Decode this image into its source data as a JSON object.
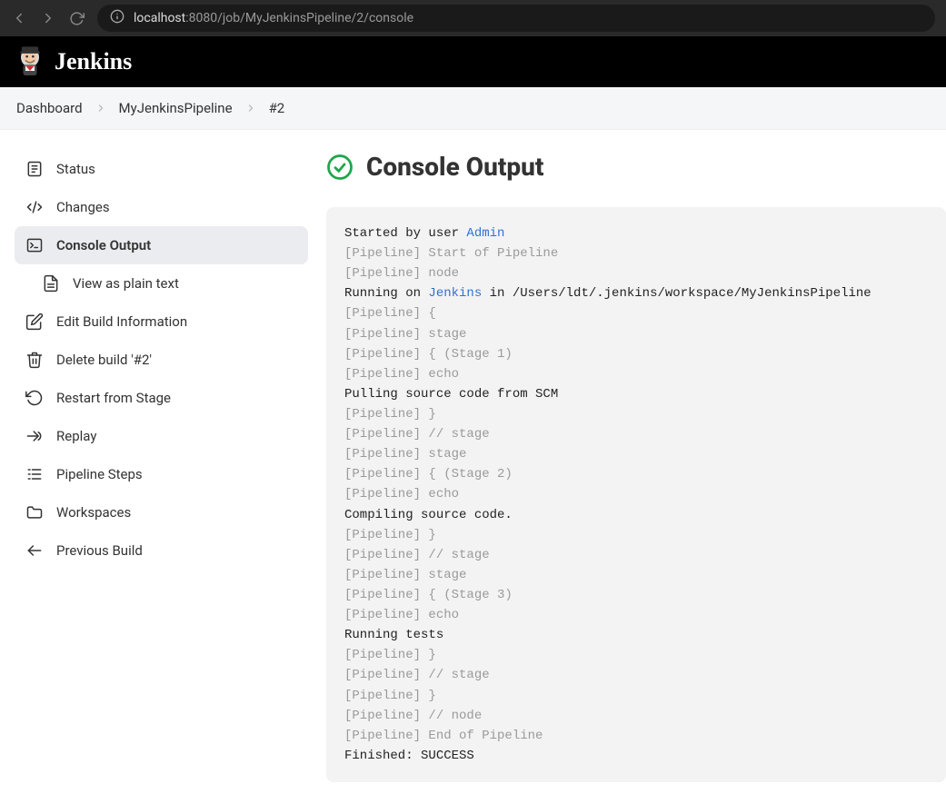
{
  "browser": {
    "url_host": "localhost",
    "url_path": ":8080/job/MyJenkinsPipeline/2/console"
  },
  "header": {
    "logo_text": "Jenkins"
  },
  "breadcrumb": {
    "items": [
      {
        "label": "Dashboard"
      },
      {
        "label": "MyJenkinsPipeline"
      },
      {
        "label": "#2"
      }
    ]
  },
  "sidebar": {
    "items": [
      {
        "label": "Status",
        "icon": "status-icon",
        "active": false,
        "sub": false
      },
      {
        "label": "Changes",
        "icon": "changes-icon",
        "active": false,
        "sub": false
      },
      {
        "label": "Console Output",
        "icon": "console-icon",
        "active": true,
        "sub": false
      },
      {
        "label": "View as plain text",
        "icon": "document-icon",
        "active": false,
        "sub": true
      },
      {
        "label": "Edit Build Information",
        "icon": "edit-icon",
        "active": false,
        "sub": false
      },
      {
        "label": "Delete build '#2'",
        "icon": "trash-icon",
        "active": false,
        "sub": false
      },
      {
        "label": "Restart from Stage",
        "icon": "restart-icon",
        "active": false,
        "sub": false
      },
      {
        "label": "Replay",
        "icon": "replay-icon",
        "active": false,
        "sub": false
      },
      {
        "label": "Pipeline Steps",
        "icon": "steps-icon",
        "active": false,
        "sub": false
      },
      {
        "label": "Workspaces",
        "icon": "folder-icon",
        "active": false,
        "sub": false
      },
      {
        "label": "Previous Build",
        "icon": "arrow-left-icon",
        "active": false,
        "sub": false
      }
    ]
  },
  "page": {
    "title": "Console Output"
  },
  "console": {
    "lines": [
      {
        "type": "user",
        "prefix": "Started by user ",
        "link": "Admin",
        "suffix": ""
      },
      {
        "type": "dim",
        "text": "[Pipeline] Start of Pipeline"
      },
      {
        "type": "dim",
        "text": "[Pipeline] node"
      },
      {
        "type": "runon",
        "prefix": "Running on ",
        "link": "Jenkins",
        "suffix": " in /Users/ldt/.jenkins/workspace/MyJenkinsPipeline"
      },
      {
        "type": "dim",
        "text": "[Pipeline] {"
      },
      {
        "type": "dim",
        "text": "[Pipeline] stage"
      },
      {
        "type": "dim",
        "text": "[Pipeline] { (Stage 1)"
      },
      {
        "type": "dim",
        "text": "[Pipeline] echo"
      },
      {
        "type": "plain",
        "text": "Pulling source code from SCM"
      },
      {
        "type": "dim",
        "text": "[Pipeline] }"
      },
      {
        "type": "dim",
        "text": "[Pipeline] // stage"
      },
      {
        "type": "dim",
        "text": "[Pipeline] stage"
      },
      {
        "type": "dim",
        "text": "[Pipeline] { (Stage 2)"
      },
      {
        "type": "dim",
        "text": "[Pipeline] echo"
      },
      {
        "type": "plain",
        "text": "Compiling source code."
      },
      {
        "type": "dim",
        "text": "[Pipeline] }"
      },
      {
        "type": "dim",
        "text": "[Pipeline] // stage"
      },
      {
        "type": "dim",
        "text": "[Pipeline] stage"
      },
      {
        "type": "dim",
        "text": "[Pipeline] { (Stage 3)"
      },
      {
        "type": "dim",
        "text": "[Pipeline] echo"
      },
      {
        "type": "plain",
        "text": "Running tests"
      },
      {
        "type": "dim",
        "text": "[Pipeline] }"
      },
      {
        "type": "dim",
        "text": "[Pipeline] // stage"
      },
      {
        "type": "dim",
        "text": "[Pipeline] }"
      },
      {
        "type": "dim",
        "text": "[Pipeline] // node"
      },
      {
        "type": "dim",
        "text": "[Pipeline] End of Pipeline"
      },
      {
        "type": "plain",
        "text": "Finished: SUCCESS"
      }
    ]
  }
}
